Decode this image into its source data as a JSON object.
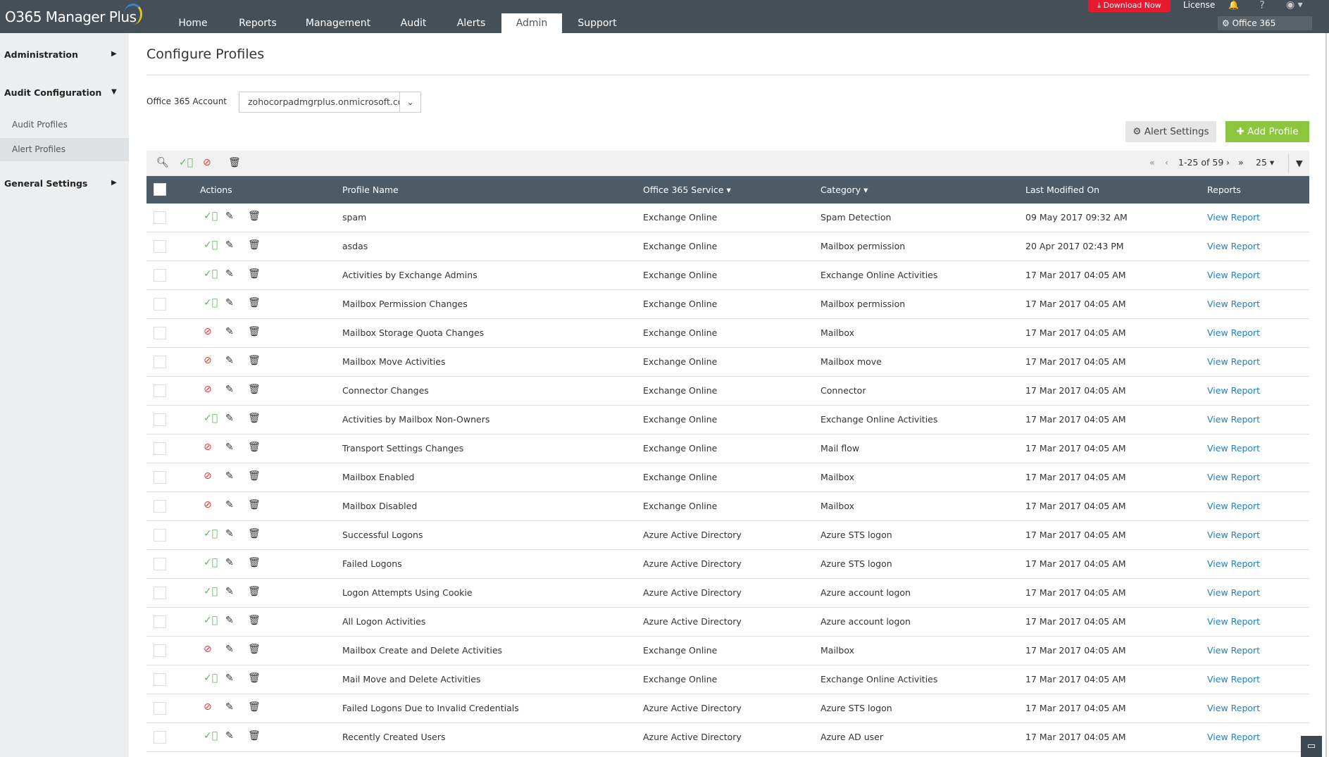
{
  "app": {
    "logo": "O365 Manager Plus"
  },
  "nav": {
    "items": [
      "Home",
      "Reports",
      "Management",
      "Audit",
      "Alerts",
      "Admin",
      "Support"
    ],
    "active": "Admin"
  },
  "topright": {
    "download": "Download Now",
    "license": "License",
    "help": "?",
    "settings": "Office 365 Settings"
  },
  "sidebar": {
    "administration": "Administration",
    "audit_configuration": "Audit Configuration",
    "audit_profiles": "Audit Profiles",
    "alert_profiles": "Alert Profiles",
    "general_settings": "General Settings"
  },
  "page": {
    "title": "Configure Profiles",
    "account_label": "Office 365 Account",
    "account_value": "zohocorpadmgrplus.onmicrosoft.com",
    "alert_settings": "Alert Settings",
    "add_profile": "Add Profile"
  },
  "pager": {
    "range": "1-25 of 59",
    "per_page": "25"
  },
  "table": {
    "headers": {
      "actions": "Actions",
      "profile": "Profile Name",
      "service": "Office 365 Service",
      "category": "Category",
      "modified": "Last Modified On",
      "reports": "Reports"
    },
    "rows": [
      {
        "enabled": true,
        "name": "spam",
        "service": "Exchange Online",
        "category": "Spam Detection",
        "modified": "09 May 2017 09:32 AM",
        "report": "View Report"
      },
      {
        "enabled": true,
        "name": "asdas",
        "service": "Exchange Online",
        "category": "Mailbox permission",
        "modified": "20 Apr 2017 02:43 PM",
        "report": "View Report"
      },
      {
        "enabled": true,
        "name": "Activities by Exchange Admins",
        "service": "Exchange Online",
        "category": "Exchange Online Activities",
        "modified": "17 Mar 2017 04:05 AM",
        "report": "View Report"
      },
      {
        "enabled": true,
        "name": "Mailbox Permission Changes",
        "service": "Exchange Online",
        "category": "Mailbox permission",
        "modified": "17 Mar 2017 04:05 AM",
        "report": "View Report"
      },
      {
        "enabled": false,
        "name": "Mailbox Storage Quota Changes",
        "service": "Exchange Online",
        "category": "Mailbox",
        "modified": "17 Mar 2017 04:05 AM",
        "report": "View Report"
      },
      {
        "enabled": false,
        "name": "Mailbox Move Activities",
        "service": "Exchange Online",
        "category": "Mailbox move",
        "modified": "17 Mar 2017 04:05 AM",
        "report": "View Report"
      },
      {
        "enabled": false,
        "name": "Connector Changes",
        "service": "Exchange Online",
        "category": "Connector",
        "modified": "17 Mar 2017 04:05 AM",
        "report": "View Report"
      },
      {
        "enabled": true,
        "name": "Activities by Mailbox Non-Owners",
        "service": "Exchange Online",
        "category": "Exchange Online Activities",
        "modified": "17 Mar 2017 04:05 AM",
        "report": "View Report"
      },
      {
        "enabled": false,
        "name": "Transport Settings Changes",
        "service": "Exchange Online",
        "category": "Mail flow",
        "modified": "17 Mar 2017 04:05 AM",
        "report": "View Report"
      },
      {
        "enabled": false,
        "name": "Mailbox Enabled",
        "service": "Exchange Online",
        "category": "Mailbox",
        "modified": "17 Mar 2017 04:05 AM",
        "report": "View Report"
      },
      {
        "enabled": false,
        "name": "Mailbox Disabled",
        "service": "Exchange Online",
        "category": "Mailbox",
        "modified": "17 Mar 2017 04:05 AM",
        "report": "View Report"
      },
      {
        "enabled": true,
        "name": "Successful Logons",
        "service": "Azure Active Directory",
        "category": "Azure STS logon",
        "modified": "17 Mar 2017 04:05 AM",
        "report": "View Report"
      },
      {
        "enabled": true,
        "name": "Failed Logons",
        "service": "Azure Active Directory",
        "category": "Azure STS logon",
        "modified": "17 Mar 2017 04:05 AM",
        "report": "View Report"
      },
      {
        "enabled": true,
        "name": "Logon Attempts Using Cookie",
        "service": "Azure Active Directory",
        "category": "Azure account logon",
        "modified": "17 Mar 2017 04:05 AM",
        "report": "View Report"
      },
      {
        "enabled": true,
        "name": "All Logon Activities",
        "service": "Azure Active Directory",
        "category": "Azure account logon",
        "modified": "17 Mar 2017 04:05 AM",
        "report": "View Report"
      },
      {
        "enabled": false,
        "name": "Mailbox Create and Delete Activities",
        "service": "Exchange Online",
        "category": "Mailbox",
        "modified": "17 Mar 2017 04:05 AM",
        "report": "View Report"
      },
      {
        "enabled": true,
        "name": "Mail Move and Delete Activities",
        "service": "Exchange Online",
        "category": "Exchange Online Activities",
        "modified": "17 Mar 2017 04:05 AM",
        "report": "View Report"
      },
      {
        "enabled": false,
        "name": "Failed Logons Due to Invalid Credentials",
        "service": "Azure Active Directory",
        "category": "Azure STS logon",
        "modified": "17 Mar 2017 04:05 AM",
        "report": "View Report"
      },
      {
        "enabled": true,
        "name": "Recently Created Users",
        "service": "Azure Active Directory",
        "category": "Azure AD user",
        "modified": "17 Mar 2017 04:05 AM",
        "report": "View Report"
      }
    ]
  },
  "colors": {
    "topbar": "#444f57",
    "header": "#4d5b66",
    "accent_green": "#8cc63f",
    "download_red": "#e8192c",
    "enabled": "#5cb85c",
    "disabled": "#e53935",
    "link": "#1a82c8"
  }
}
